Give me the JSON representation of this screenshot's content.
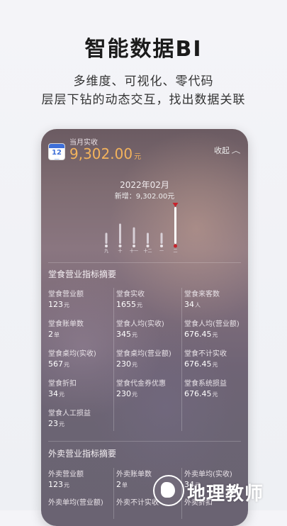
{
  "hero": {
    "title": "智能数据BI",
    "line1": "多维度、可视化、零代码",
    "line2": "层层下钻的动态交互，找出数据关联"
  },
  "summary": {
    "calendar_day": "12月",
    "label": "当月实收",
    "value": "9,302.00",
    "unit": "元",
    "collapse_label": "收起"
  },
  "chart": {
    "month": "2022年02月",
    "added": "新增：9,302.00元"
  },
  "chart_data": {
    "type": "bar",
    "categories": [
      "九",
      "十",
      "十一",
      "十二",
      "一",
      "二"
    ],
    "values": [
      0.3,
      0.55,
      0.45,
      0.3,
      0.3,
      1.0
    ],
    "highlight": "二",
    "colors": {
      "bar": "#d7cfd6",
      "highlight": "#ffffff",
      "marker": "#c8232c"
    }
  },
  "dine_in": {
    "title": "堂食营业指标摘要",
    "metrics": [
      {
        "key": "堂食营业额",
        "value": "123",
        "unit": "元"
      },
      {
        "key": "堂食实收",
        "value": "1655",
        "unit": "元"
      },
      {
        "key": "堂食来客数",
        "value": "34",
        "unit": "人"
      },
      {
        "key": "堂食账单数",
        "value": "2",
        "unit": "单"
      },
      {
        "key": "堂食人均(实收)",
        "value": "345",
        "unit": "元"
      },
      {
        "key": "堂食人均(营业额)",
        "value": "676.45",
        "unit": "元"
      },
      {
        "key": "堂食桌均(实收)",
        "value": "567",
        "unit": "元"
      },
      {
        "key": "堂食桌均(营业额)",
        "value": "230",
        "unit": "元"
      },
      {
        "key": "堂食不计实收",
        "value": "676.45",
        "unit": "元"
      },
      {
        "key": "堂食折扣",
        "value": "34",
        "unit": "元"
      },
      {
        "key": "堂食代金券优惠",
        "value": "230",
        "unit": "元"
      },
      {
        "key": "堂食系统损益",
        "value": "676.45",
        "unit": "元"
      },
      {
        "key": "堂食人工损益",
        "value": "23",
        "unit": "元"
      }
    ]
  },
  "takeout": {
    "title": "外卖营业指标摘要",
    "metrics": [
      {
        "key": "外卖营业额",
        "value": "123",
        "unit": "元"
      },
      {
        "key": "外卖账单数",
        "value": "2",
        "unit": "单"
      },
      {
        "key": "外卖单均(实收)",
        "value": "34",
        "unit": "元"
      },
      {
        "key": "外卖单均(营业额)",
        "value": "",
        "unit": ""
      },
      {
        "key": "外卖不计实收",
        "value": "",
        "unit": ""
      },
      {
        "key": "外卖折扣",
        "value": "",
        "unit": ""
      }
    ]
  },
  "watermark": {
    "text": "地理教师"
  }
}
